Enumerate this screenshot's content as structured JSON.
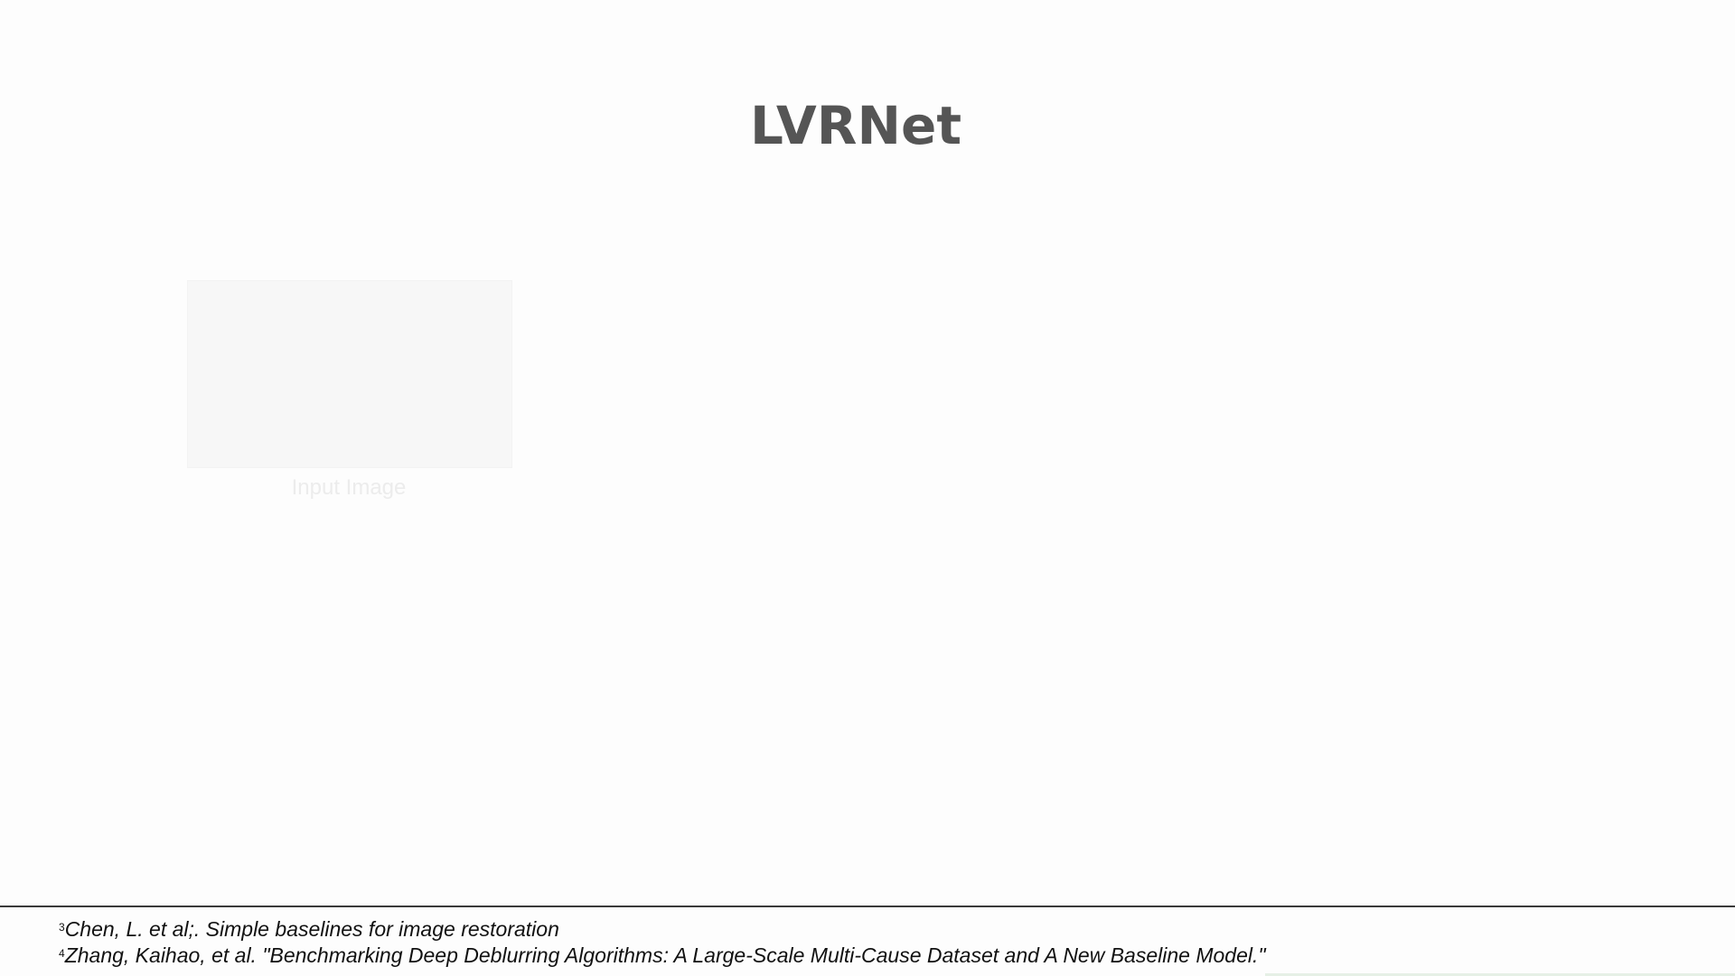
{
  "slide": {
    "title": "LVRNet",
    "input_label": "Input Image"
  },
  "references": [
    {
      "num": "3",
      "text": "Chen, L. et al;. Simple baselines for image restoration"
    },
    {
      "num": "4",
      "text": "Zhang, Kaihao, et al. \"Benchmarking Deep Deblurring Algorithms: A Large-Scale Multi-Cause Dataset and A New Baseline Model.\""
    }
  ],
  "colors": {
    "title": "#555555",
    "rule": "#3a3a3a",
    "background": "#fdfdfd"
  }
}
